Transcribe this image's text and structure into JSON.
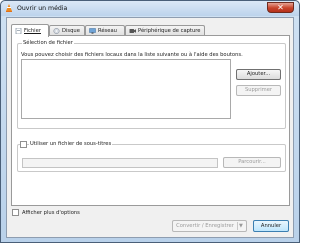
{
  "window": {
    "title": "Ouvrir un média",
    "close_glyph": "✕"
  },
  "tabs": [
    {
      "label": "Fichier",
      "icon": "file-icon",
      "active": true
    },
    {
      "label": "Disque",
      "icon": "disc-icon",
      "active": false
    },
    {
      "label": "Réseau",
      "icon": "network-icon",
      "active": false
    },
    {
      "label": "Périphérique de capture",
      "icon": "capture-device-icon",
      "active": false
    }
  ],
  "file_selection": {
    "legend": "Sélection de fichier",
    "hint": "Vous pouvez choisir des fichiers locaux dans la liste suivante ou à l'aide des boutons.",
    "add_label": "Ajouter...",
    "remove_label": "Supprimer"
  },
  "subtitles": {
    "checkbox_label": "Utiliser un fichier de sous-titres",
    "browse_label": "Parcourir..."
  },
  "footer": {
    "more_options_label": "Afficher plus d'options",
    "convert_label": "Convertir / Enregistrer",
    "cancel_label": "Annuler"
  }
}
